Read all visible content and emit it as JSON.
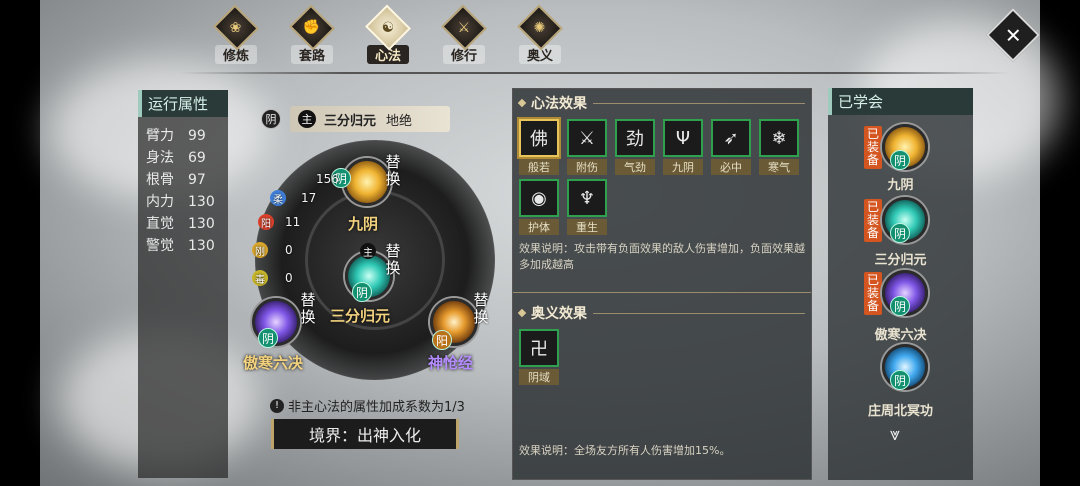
{
  "tabs": [
    {
      "label": "修炼",
      "icon": "cultivate-icon"
    },
    {
      "label": "套路",
      "icon": "fist-icon"
    },
    {
      "label": "心法",
      "icon": "heart-method-icon",
      "active": true
    },
    {
      "label": "修行",
      "icon": "practice-icon"
    },
    {
      "label": "奥义",
      "icon": "esoteric-icon"
    }
  ],
  "close_icon": "✕",
  "stats": {
    "title": "运行属性",
    "rows": [
      {
        "k": "臂力",
        "v": "99"
      },
      {
        "k": "身法",
        "v": "69"
      },
      {
        "k": "根骨",
        "v": "97"
      },
      {
        "k": "内力",
        "v": "130"
      },
      {
        "k": "直觉",
        "v": "130"
      },
      {
        "k": "警觉",
        "v": "130"
      }
    ]
  },
  "main_heart": {
    "yin_badge": "阴",
    "zhu": "主",
    "name": "三分归元",
    "attr": "地绝"
  },
  "slots": {
    "top": {
      "label": "九阴",
      "replace": "替换",
      "yin": "阴",
      "value": "156"
    },
    "center": {
      "label": "三分归元",
      "replace": "替换",
      "yin": "阴",
      "zhu": "主"
    },
    "left": {
      "label": "傲寒六决",
      "replace": "替换",
      "yin": "阴"
    },
    "right": {
      "label": "神怆经",
      "replace": "替换",
      "yin": "阳"
    }
  },
  "small_stats": [
    {
      "chip": "柔",
      "value": "17",
      "color": "#3f7fd9"
    },
    {
      "chip": "阳",
      "value": "11",
      "color": "#d9412b"
    },
    {
      "chip": "刚",
      "value": "0",
      "color": "#d9a62b"
    },
    {
      "chip": "毒",
      "value": "0",
      "color": "#c7b52b"
    }
  ],
  "note": {
    "icon": "!",
    "text": "非主心法的属性加成系数为1/3"
  },
  "realm": "境界：出神入化",
  "effects": {
    "heart_title": "心法效果",
    "skills": [
      {
        "name": "般若",
        "icon": "佛",
        "selected": true
      },
      {
        "name": "附伤",
        "icon": "⚔"
      },
      {
        "name": "气劲",
        "icon": "劲"
      },
      {
        "name": "九阴",
        "icon": "Ψ"
      },
      {
        "name": "必中",
        "icon": "➶"
      },
      {
        "name": "寒气",
        "icon": "❄"
      },
      {
        "name": "护体",
        "icon": "◉"
      },
      {
        "name": "重生",
        "icon": "♆"
      }
    ],
    "heart_desc": "效果说明：攻击带有负面效果的敌人伤害增加，负面效果越多加成越高",
    "eso_title": "奥义效果",
    "eso_skills": [
      {
        "name": "阴域",
        "icon": "卍"
      }
    ],
    "eso_desc": "效果说明：全场友方所有人伤害增加15%。"
  },
  "learned": {
    "title": "已学会",
    "items": [
      {
        "name": "九阴",
        "equipped": "已装备",
        "yin": "阴"
      },
      {
        "name": "三分归元",
        "equipped": "已装备",
        "yin": "阴"
      },
      {
        "name": "傲寒六决",
        "equipped": "已装备",
        "yin": "阴"
      },
      {
        "name": "庄周北冥功",
        "equipped": "",
        "yin": "阴"
      }
    ],
    "more_icon": "⩔"
  }
}
